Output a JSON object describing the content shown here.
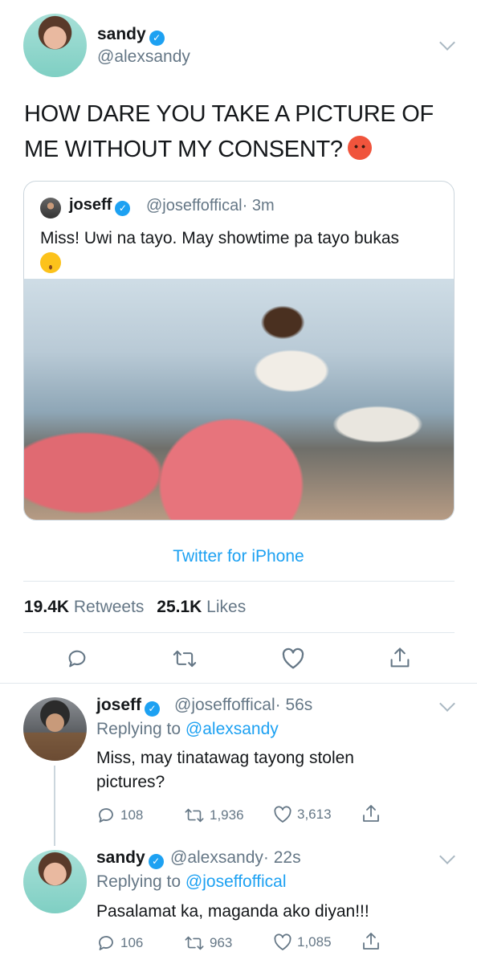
{
  "tweet": {
    "author_name": "sandy",
    "author_handle": "@alexsandy",
    "text": "HOW DARE YOU TAKE A PICTURE OF ME WITHOUT MY CONSENT?",
    "quoted": {
      "author_name": "joseff",
      "author_handle": "@joseffoffical",
      "time": "· 3m",
      "text": "Miss! Uwi na tayo. May showtime pa tayo bukas"
    },
    "source": "Twitter for iPhone",
    "retweets_count": "19.4K",
    "retweets_label": "Retweets",
    "likes_count": "25.1K",
    "likes_label": "Likes"
  },
  "replies": [
    {
      "author_name": "joseff",
      "author_handle": "@joseffoffical",
      "time": "· 56s",
      "replying_label": "Replying to",
      "replying_to": "@alexsandy",
      "text": "Miss, may tinatawag tayong stolen pictures?",
      "replies": "108",
      "retweets": "1,936",
      "likes": "3,613"
    },
    {
      "author_name": "sandy",
      "author_handle": "@alexsandy",
      "time": "· 22s",
      "replying_label": "Replying to",
      "replying_to": "@joseffoffical",
      "text": "Pasalamat ka, maganda ako diyan!!!",
      "replies": "106",
      "retweets": "963",
      "likes": "1,085"
    }
  ],
  "icons": {
    "verified": "verified-badge-icon",
    "reply": "reply-icon",
    "retweet": "retweet-icon",
    "like": "heart-icon",
    "share": "share-icon",
    "menu": "chevron-down-icon"
  },
  "colors": {
    "accent": "#1da1f2",
    "muted": "#657786",
    "text": "#14171a",
    "border": "#e1e8ed"
  }
}
